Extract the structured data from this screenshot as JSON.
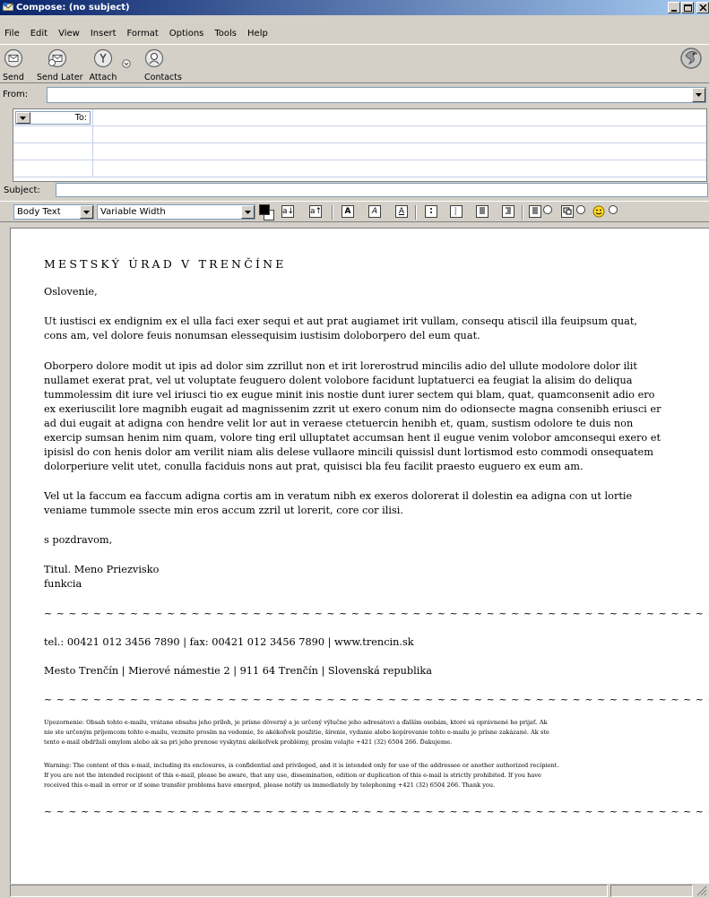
{
  "window": {
    "title": "Compose: (no subject)"
  },
  "menu": [
    "File",
    "Edit",
    "View",
    "Insert",
    "Format",
    "Options",
    "Tools",
    "Help"
  ],
  "toolbar": {
    "send_label": "Send",
    "send_later_label": "Send Later",
    "attach_label": "Attach",
    "contacts_label": "Contacts"
  },
  "header": {
    "from_label": "From:",
    "from_value": "",
    "to_label": "To:",
    "subject_label": "Subject:",
    "subject_value": ""
  },
  "format_toolbar": {
    "paragraph_style": "Body Text",
    "font": "Variable Width"
  },
  "message": {
    "heading": "MESTSKÝ ÚRAD V TRENČÍNE",
    "greeting": "Oslovenie,",
    "para1": [
      "Ut iustisci ex endignim ex el ulla faci exer sequi et aut prat augiamet irit vullam, consequ atiscil illa feuipsum quat,",
      "cons am, vel dolore feuis nonumsan elessequisim iustisim doloborpero del eum quat."
    ],
    "para2": [
      "Oborpero dolore modit ut ipis ad dolor sim zzrillut non et irit lorerostrud mincilis adio del ullute modolore dolor ilit",
      "nullamet exerat prat, vel ut voluptate feuguero dolent volobore facidunt luptatuerci ea feugiat la alisim do deliqua",
      "tummolessim dit iure vel iriusci tio ex eugue minit inis nostie dunt iurer sectem qui blam, quat, quamconsenit adio ero",
      "ex exeriuscilit lore magnibh eugait ad magnissenim zzrit ut exero conum nim do odionsecte magna consenibh eriusci er",
      "ad dui eugait at adigna con hendre velit lor aut in veraese ctetuercin henibh et, quam, sustism odolore te duis non",
      "exercip sumsan henim nim quam, volore ting eril ulluptatet accumsan hent il eugue venim volobor amconsequi exero et",
      "ipisisl do con henis dolor am verilit niam alis delese vullaore mincili quissisl dunt lortismod esto commodi onsequatem",
      "dolorperiure velit utet, conulla faciduis nons aut prat, quisisci bla feu facilit praesto euguero ex eum am."
    ],
    "para3": [
      "Vel ut la faccum ea faccum adigna cortis am in veratum nibh ex exeros dolorerat il dolestin ea adigna con ut lortie",
      "veniame tummole ssecte min eros accum zzril ut lorerit, core cor ilisi."
    ],
    "closing": "s pozdravom,",
    "signature_name": "Titul. Meno Priezvisko",
    "signature_role": "funkcia",
    "separator": "~ ~ ~ ~ ~ ~ ~ ~ ~ ~ ~ ~ ~ ~ ~ ~ ~ ~ ~ ~ ~ ~ ~ ~ ~ ~ ~ ~ ~ ~ ~ ~ ~ ~ ~ ~ ~ ~ ~ ~ ~ ~ ~ ~ ~ ~ ~ ~ ~ ~ ~ ~ ~ ~ ~ ~ ~ ~ ~ ~ ~ ~ ~",
    "contact_line": "tel.: 00421 012 3456 7890 | fax: 00421 012 3456 7890 | www.trencin.sk",
    "address_line": "Mesto Trenčín | Mierové námestie 2 | 911 64 Trenčín | Slovenská republika",
    "notice_sk": [
      "Upozornenie: Obsah tohto e-mailu, vrátane obsahu jeho príloh, je prísne dôverný a je určený výlučne jeho adresátovi a ďalším osobám, ktoré sú oprávnené ho prijať. Ak",
      "nie ste určeným príjemcom tohto e-mailu, vezmite prosím na vedomie, že akékoľvek použitie, šírenie, vydanie alebo kopírovanie tohto e-mailu je prísne zakázané. Ak ste",
      "tento e-mail obdŕžali omylom alebo ak sa pri jeho prenose vyskytnú akékoľvek problémy, prosím volajte +421 (32) 6504 266. Ďakujeme."
    ],
    "notice_en": [
      "Warning: The content of this e-mail, including its enclosures, is confidential and privileged, and it is intended only for use of the addressee or another authorized recipient.",
      "If you are not the intended recipient of this e-mail, please be aware, that any use, dissemination, edition or duplication of this e-mail is strictly prohibited. If you have",
      "received this e-mail in error or if some transfer problems have emerged, please notify us immediately by telephoning +421 (32) 6504 266. Thank you."
    ]
  }
}
